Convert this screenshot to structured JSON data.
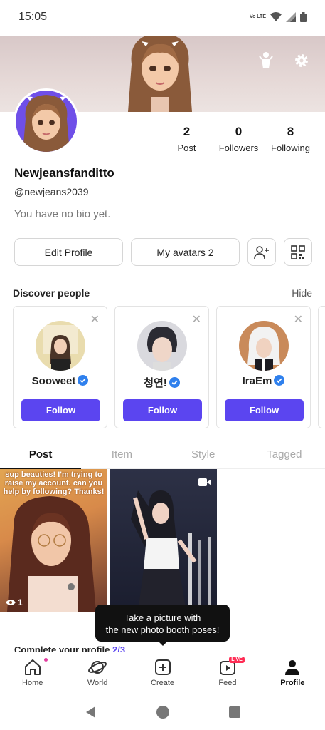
{
  "status_bar": {
    "time": "15:05",
    "network": "Vo LTE"
  },
  "profile": {
    "display_name": "Newjeansfanditto",
    "handle": "@newjeans2039",
    "bio": "You have no bio yet.",
    "stats": [
      {
        "value": "2",
        "label": "Post"
      },
      {
        "value": "0",
        "label": "Followers"
      },
      {
        "value": "8",
        "label": "Following"
      }
    ]
  },
  "actions": {
    "edit_profile": "Edit Profile",
    "my_avatars": "My avatars 2"
  },
  "discover": {
    "title": "Discover people",
    "hide": "Hide",
    "people": [
      {
        "name": "Sooweet",
        "follow": "Follow"
      },
      {
        "name": "청연!",
        "follow": "Follow"
      },
      {
        "name": "IraEm",
        "follow": "Follow"
      }
    ]
  },
  "tabs": [
    {
      "label": "Post"
    },
    {
      "label": "Item"
    },
    {
      "label": "Style"
    },
    {
      "label": "Tagged"
    }
  ],
  "posts": [
    {
      "caption": "sup beauties! I'm trying to raise my account. can you help by following? Thanks!",
      "views": "1"
    },
    {
      "type": "video"
    }
  ],
  "complete_profile": {
    "text": "Complete your profile",
    "progress": "2/3"
  },
  "tooltip": {
    "line1": "Take a picture with",
    "line2": "the new photo booth poses!"
  },
  "bottom_nav": [
    {
      "label": "Home"
    },
    {
      "label": "World"
    },
    {
      "label": "Create"
    },
    {
      "label": "Feed",
      "badge": "LIVE"
    },
    {
      "label": "Profile"
    }
  ],
  "colors": {
    "accent": "#5b45f0",
    "verified": "#2f80ed",
    "live": "#ff2d55"
  }
}
